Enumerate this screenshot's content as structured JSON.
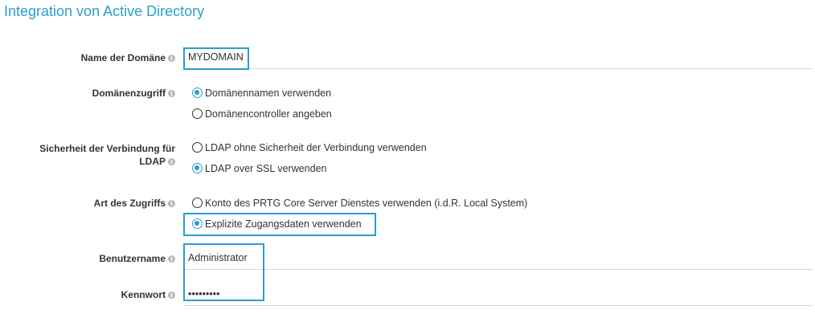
{
  "title": "Integration von Active Directory",
  "colors": {
    "accent": "#2a9dd0",
    "text": "#333333",
    "info_icon": "#b8b8b8"
  },
  "info_icon_glyph": "i",
  "domain_name": {
    "label": "Name der Domäne",
    "value": "MYDOMAIN"
  },
  "domain_access": {
    "label": "Domänenzugriff",
    "options": [
      {
        "label": "Domänennamen verwenden",
        "checked": true
      },
      {
        "label": "Domänencontroller angeben",
        "checked": false
      }
    ]
  },
  "ldap_security": {
    "label_line1": "Sicherheit der Verbindung für",
    "label_line2": "LDAP",
    "options": [
      {
        "label": "LDAP ohne Sicherheit der Verbindung verwenden",
        "checked": false
      },
      {
        "label": "LDAP over SSL verwenden",
        "checked": true
      }
    ]
  },
  "access_type": {
    "label": "Art des Zugriffs",
    "options": [
      {
        "label": "Konto des PRTG Core Server Dienstes verwenden (i.d.R. Local System)",
        "checked": false
      },
      {
        "label": "Explizite Zugangsdaten verwenden",
        "checked": true
      }
    ]
  },
  "username": {
    "label": "Benutzername",
    "value": "Administrator"
  },
  "password": {
    "label": "Kennwort",
    "value": "•••••••••"
  }
}
